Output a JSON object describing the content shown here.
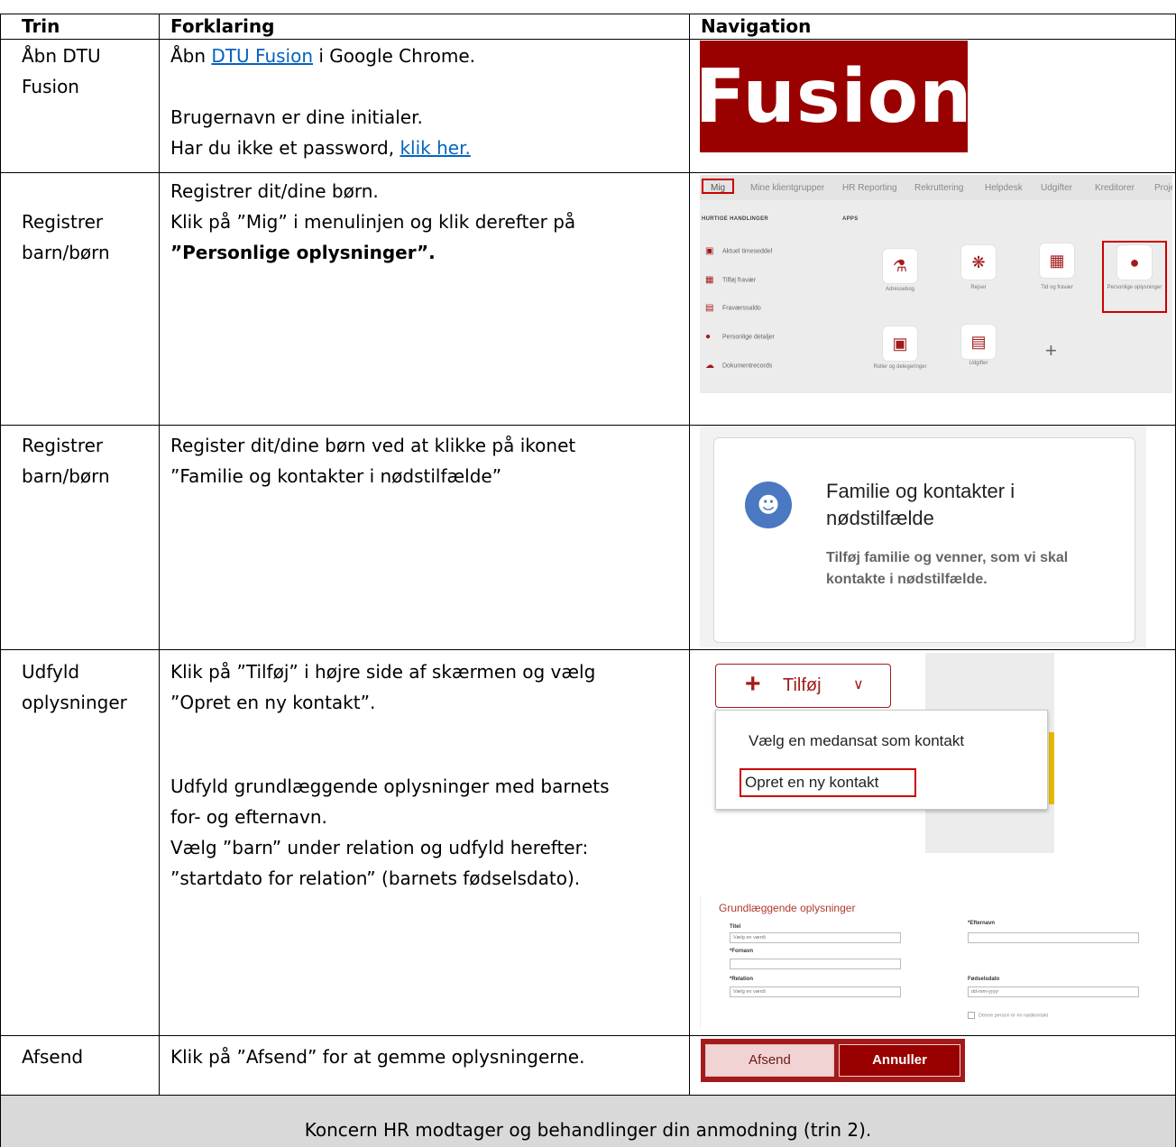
{
  "headers": {
    "trin": "Trin",
    "forklaring": "Forklaring",
    "navigation": "Navigation"
  },
  "rows": [
    {
      "trin": [
        "Åbn DTU",
        "Fusion"
      ],
      "explain_prefix": "Åbn ",
      "explain_link": "DTU Fusion",
      "explain_suffix": " i Google Chrome.",
      "explain_line2": "Brugernavn er dine initialer.",
      "explain_line3_prefix": "Har du ikke et password, ",
      "explain_line3_link": "klik her."
    },
    {
      "trin": [
        "Registrer",
        "barn/børn"
      ],
      "explain": [
        "Registrer dit/dine børn.",
        "Klik på ”Mig” i menulinjen og klik derefter på",
        "”Personlige oplysninger”."
      ]
    },
    {
      "trin": [
        "Registrer",
        "barn/børn"
      ],
      "explain": [
        "Register dit/dine børn ved at klikke på ikonet",
        "”Familie og kontakter i nødstilfælde”"
      ]
    },
    {
      "trin": [
        "Udfyld",
        "oplysninger"
      ],
      "explain_a": [
        "Klik på ”Tilføj” i højre side af skærmen og vælg",
        "”Opret en ny kontakt”."
      ],
      "explain_b": [
        "Udfyld grundlæggende oplysninger med barnets",
        "for- og efternavn.",
        "Vælg ”barn” under relation og udfyld herefter:",
        "”startdato for relation” (barnets fødselsdato)."
      ]
    },
    {
      "trin": [
        "Afsend"
      ],
      "explain": "Klik på ”Afsend” for at gemme oplysningerne."
    }
  ],
  "footer": "Koncern HR modtager og behandlinger din anmodning (trin 2).",
  "fusion_logo": "Fusion",
  "menu_shot": {
    "tabs": [
      "Mig",
      "Mine klientgrupper",
      "HR Reporting",
      "Rekruttering",
      "Helpdesk",
      "Udgifter",
      "Kreditorer",
      "Proje"
    ],
    "quick_title": "HURTIGE HANDLINGER",
    "apps_title": "APPS",
    "quick": [
      "Aktuel timeseddel",
      "Tilføj fravær",
      "Fraværssaldo",
      "Personlige detaljer",
      "Dokumentrecords"
    ],
    "apps": [
      "Adressebog",
      "Rejser",
      "Tid og fravær",
      "Personlige oplysninger",
      "Roller og delegeringer",
      "Udgifter"
    ]
  },
  "family_shot": {
    "title": "Familie og kontakter i nødstilfælde",
    "desc": "Tilføj familie og venner, som vi skal kontakte i nødstilfælde."
  },
  "tilfoj_shot": {
    "button": "Tilføj",
    "opt1": "Vælg en medansat som kontakt",
    "opt2": "Opret en ny kontakt"
  },
  "form_shot": {
    "title": "Grundlæggende oplysninger",
    "titel_label": "Titel",
    "titel_placeholder": "Vælg en værdi",
    "efternavn_label": "*Efternavn",
    "fornavn_label": "*Fornavn",
    "relation_label": "*Relation",
    "relation_placeholder": "Vælg en værdi",
    "fodselsdato_label": "Fødselsdato",
    "fodselsdato_placeholder": "dd-mm-yyyy",
    "checkbox": "Denne person er en nødkontakt"
  },
  "btn_shot": {
    "afsend": "Afsend",
    "annuller": "Annuller"
  }
}
